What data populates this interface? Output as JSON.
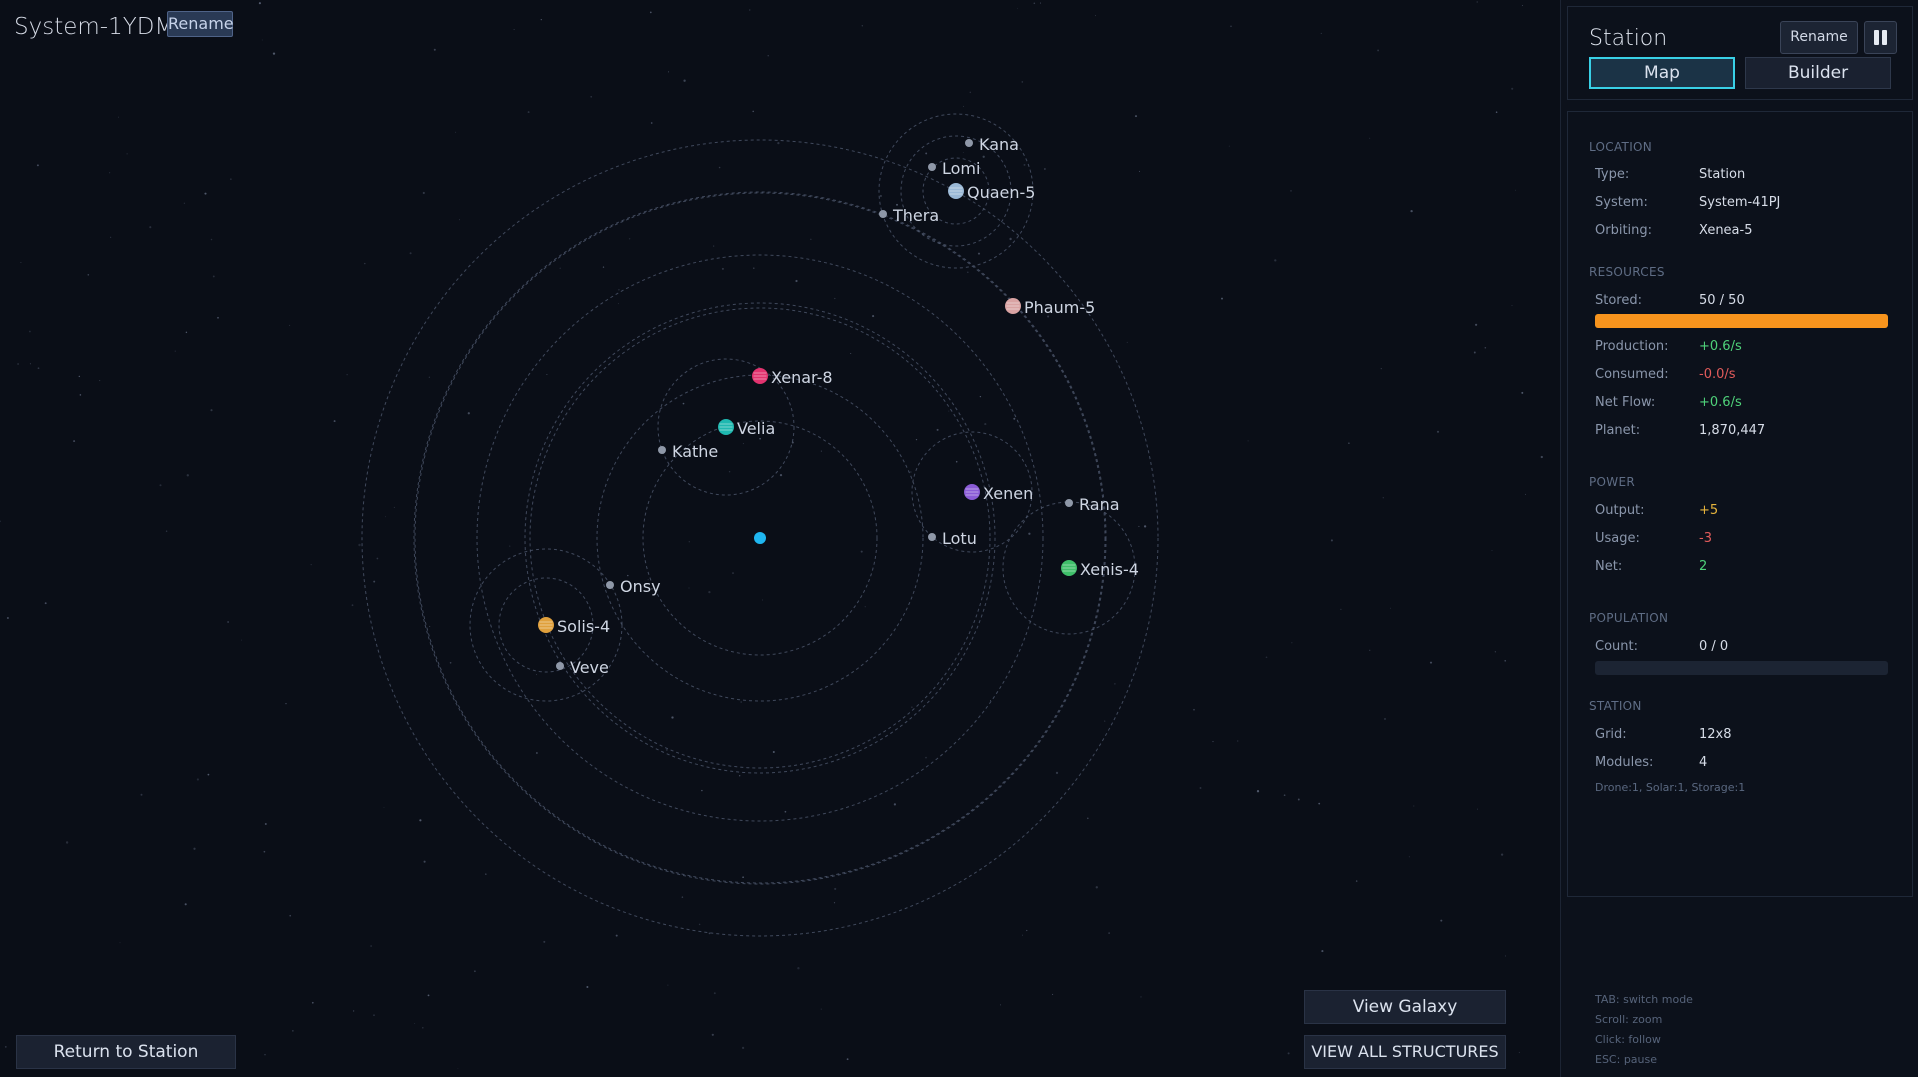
{
  "header": {
    "system_name": "System-1YDM",
    "rename_label": "Rename"
  },
  "map": {
    "bodies": [
      {
        "name": "Kana",
        "kind": "moon"
      },
      {
        "name": "Lomi",
        "kind": "moon"
      },
      {
        "name": "Quaen-5",
        "kind": "planet",
        "color": "#9ab8d6"
      },
      {
        "name": "Thera",
        "kind": "moon"
      },
      {
        "name": "Phaum-5",
        "kind": "planet",
        "color": "#d9a3a3"
      },
      {
        "name": "Xenar-8",
        "kind": "planet",
        "color": "#e2336f"
      },
      {
        "name": "Velia",
        "kind": "planet",
        "color": "#1fb8b0"
      },
      {
        "name": "Kathe",
        "kind": "moon"
      },
      {
        "name": "Xenen",
        "kind": "planet",
        "color": "#8a5bd6"
      },
      {
        "name": "Rana",
        "kind": "moon"
      },
      {
        "name": "Lotu",
        "kind": "moon"
      },
      {
        "name": "Xenis-4",
        "kind": "planet",
        "color": "#3fbf6a"
      },
      {
        "name": "Onsy",
        "kind": "moon"
      },
      {
        "name": "Solis-4",
        "kind": "planet",
        "color": "#e0a03c"
      },
      {
        "name": "Veve",
        "kind": "moon"
      }
    ],
    "star_color": "#1fb6f0"
  },
  "buttons": {
    "view_galaxy": "View Galaxy",
    "view_all_structures": "VIEW ALL STRUCTURES",
    "return_to_station": "Return to Station"
  },
  "panel": {
    "title": "Station",
    "rename": "Rename",
    "tabs": {
      "map": "Map",
      "builder": "Builder"
    },
    "location": {
      "section": "LOCATION",
      "type_label": "Type:",
      "type_value": "Station",
      "system_label": "System:",
      "system_value": "System-41PJ",
      "orbiting_label": "Orbiting:",
      "orbiting_value": "Xenea-5"
    },
    "resources": {
      "section": "RESOURCES",
      "stored_label": "Stored:",
      "stored_value": "50 / 50",
      "stored_fraction": 1.0,
      "production_label": "Production:",
      "production_value": "+0.6/s",
      "consumed_label": "Consumed:",
      "consumed_value": "-0.0/s",
      "netflow_label": "Net Flow:",
      "netflow_value": "+0.6/s",
      "planet_label": "Planet:",
      "planet_value": "1,870,447"
    },
    "power": {
      "section": "POWER",
      "output_label": "Output:",
      "output_value": "+5",
      "usage_label": "Usage:",
      "usage_value": "-3",
      "net_label": "Net:",
      "net_value": "2"
    },
    "population": {
      "section": "POPULATION",
      "count_label": "Count:",
      "count_value": "0 / 0",
      "count_fraction": 0
    },
    "station": {
      "section": "STATION",
      "grid_label": "Grid:",
      "grid_value": "12x8",
      "modules_label": "Modules:",
      "modules_value": "4",
      "modules_note": "Drone:1, Solar:1, Storage:1"
    },
    "help": [
      "TAB: switch mode",
      "Scroll: zoom",
      "Click: follow",
      "ESC: pause"
    ]
  },
  "colors": {
    "accent": "#39d0e6",
    "resource_bar": "#f7941d",
    "positive": "#4fd27a",
    "negative": "#e25b5b",
    "power_output": "#e6b43c"
  }
}
